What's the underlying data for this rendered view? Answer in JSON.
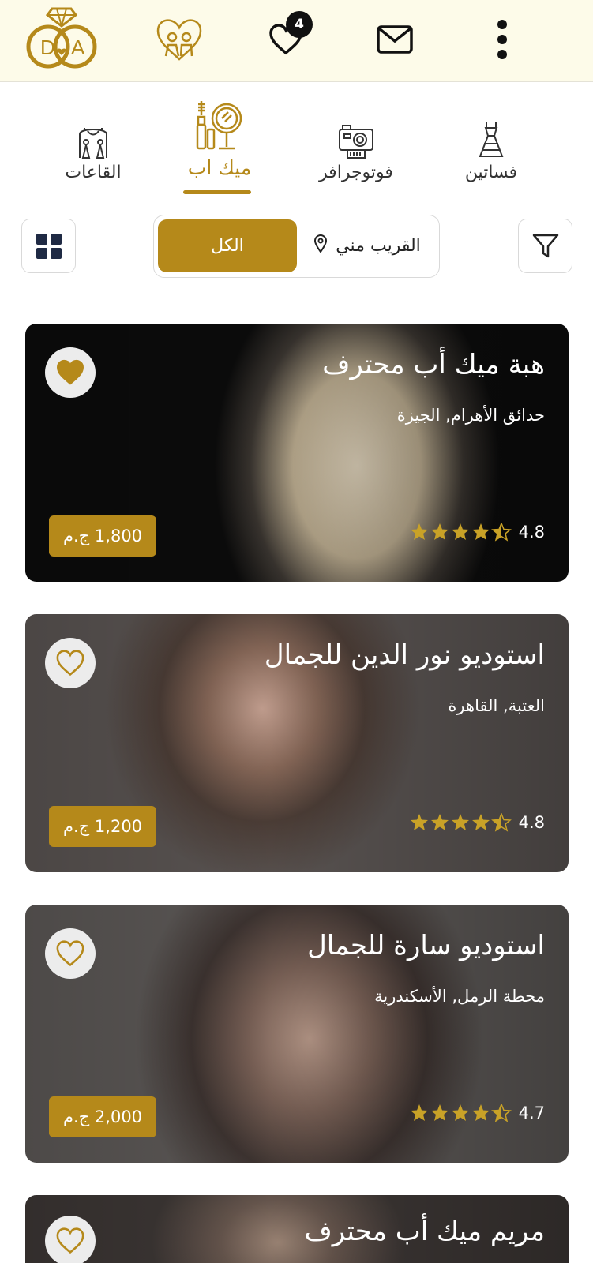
{
  "header": {
    "logo_icon": "rings-logo-icon",
    "couple_icon": "couple-heart-icon",
    "favorites_icon": "heart-icon",
    "favorites_count": "4",
    "messages_icon": "mail-icon",
    "menu_icon": "more-vertical-icon"
  },
  "categories": [
    {
      "label": "فساتين",
      "icon": "dress-icon"
    },
    {
      "label": "فوتوجرافر",
      "icon": "camera-icon"
    },
    {
      "label": "ميك اب",
      "icon": "makeup-mirror-icon",
      "active": true
    },
    {
      "label": "القاعات",
      "icon": "wedding-hall-icon"
    }
  ],
  "filters": {
    "filter_icon": "filter-icon",
    "nearby_label": "القريب مني",
    "nearby_icon": "location-pin-icon",
    "all_label": "الكل",
    "grid_icon": "grid-view-icon"
  },
  "listings": [
    {
      "title": "هبة ميك أب محترف",
      "location": "حدائق الأهرام, الجيزة",
      "rating": "4.8",
      "price": "1,800 ج.م",
      "favorited": true
    },
    {
      "title": "استوديو نور الدين للجمال",
      "location": "العتبة, القاهرة",
      "rating": "4.8",
      "price": "1,200 ج.م",
      "favorited": false
    },
    {
      "title": "استوديو سارة للجمال",
      "location": "محطة الرمل, الأسكندرية",
      "rating": "4.7",
      "price": "2,000 ج.م",
      "favorited": false
    },
    {
      "title": "مريم ميك أب محترف",
      "location": "",
      "rating": "",
      "price": "",
      "favorited": false
    }
  ],
  "colors": {
    "accent": "#b5891a",
    "header_bg": "#fdfbe9",
    "star": "#c9a227"
  }
}
